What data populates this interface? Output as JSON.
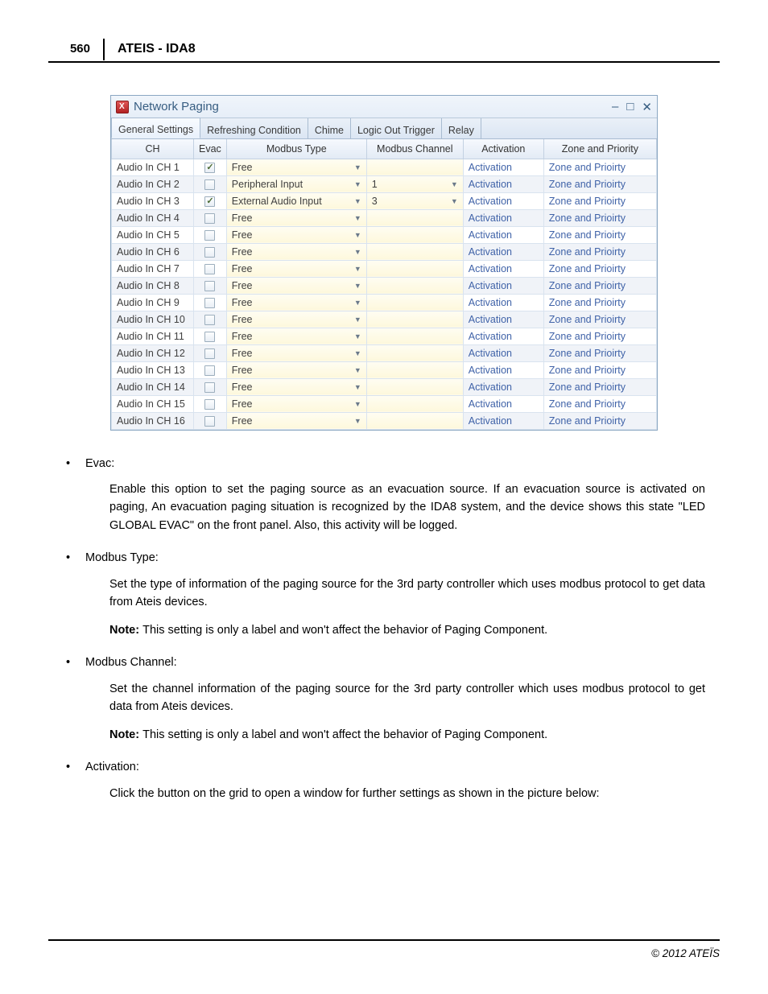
{
  "page": {
    "number": "560",
    "title": "ATEIS - IDA8",
    "footer": "© 2012 ATEÏS"
  },
  "window": {
    "title": "Network Paging",
    "tabs": [
      "General Settings",
      "Refreshing Condition",
      "Chime",
      "Logic Out Trigger",
      "Relay"
    ],
    "active_tab_index": 0,
    "columns": [
      "CH",
      "Evac",
      "Modbus Type",
      "Modbus Channel",
      "Activation",
      "Zone and  Priority"
    ],
    "rows": [
      {
        "ch": "Audio In CH 1",
        "evac": true,
        "mtype": "Free",
        "mchan": "",
        "act": "Activation",
        "zone": "Zone and Prioirty"
      },
      {
        "ch": "Audio In CH 2",
        "evac": false,
        "mtype": "Peripheral Input",
        "mchan": "1",
        "act": "Activation",
        "zone": "Zone and Prioirty"
      },
      {
        "ch": "Audio In CH 3",
        "evac": true,
        "mtype": "External Audio Input",
        "mchan": "3",
        "act": "Activation",
        "zone": "Zone and Prioirty"
      },
      {
        "ch": "Audio In CH 4",
        "evac": false,
        "mtype": "Free",
        "mchan": "",
        "act": "Activation",
        "zone": "Zone and Prioirty"
      },
      {
        "ch": "Audio In CH 5",
        "evac": false,
        "mtype": "Free",
        "mchan": "",
        "act": "Activation",
        "zone": "Zone and Prioirty"
      },
      {
        "ch": "Audio In CH 6",
        "evac": false,
        "mtype": "Free",
        "mchan": "",
        "act": "Activation",
        "zone": "Zone and Prioirty"
      },
      {
        "ch": "Audio In CH 7",
        "evac": false,
        "mtype": "Free",
        "mchan": "",
        "act": "Activation",
        "zone": "Zone and Prioirty"
      },
      {
        "ch": "Audio In CH 8",
        "evac": false,
        "mtype": "Free",
        "mchan": "",
        "act": "Activation",
        "zone": "Zone and Prioirty"
      },
      {
        "ch": "Audio In CH 9",
        "evac": false,
        "mtype": "Free",
        "mchan": "",
        "act": "Activation",
        "zone": "Zone and Prioirty"
      },
      {
        "ch": "Audio In CH 10",
        "evac": false,
        "mtype": "Free",
        "mchan": "",
        "act": "Activation",
        "zone": "Zone and Prioirty"
      },
      {
        "ch": "Audio In CH 11",
        "evac": false,
        "mtype": "Free",
        "mchan": "",
        "act": "Activation",
        "zone": "Zone and Prioirty"
      },
      {
        "ch": "Audio In CH 12",
        "evac": false,
        "mtype": "Free",
        "mchan": "",
        "act": "Activation",
        "zone": "Zone and Prioirty"
      },
      {
        "ch": "Audio In CH 13",
        "evac": false,
        "mtype": "Free",
        "mchan": "",
        "act": "Activation",
        "zone": "Zone and Prioirty"
      },
      {
        "ch": "Audio In CH 14",
        "evac": false,
        "mtype": "Free",
        "mchan": "",
        "act": "Activation",
        "zone": "Zone and Prioirty"
      },
      {
        "ch": "Audio In CH 15",
        "evac": false,
        "mtype": "Free",
        "mchan": "",
        "act": "Activation",
        "zone": "Zone and Prioirty"
      },
      {
        "ch": "Audio In CH 16",
        "evac": false,
        "mtype": "Free",
        "mchan": "",
        "act": "Activation",
        "zone": "Zone and Prioirty"
      }
    ]
  },
  "doc": {
    "items": [
      {
        "title": "Evac:",
        "desc": "Enable this option to set the paging source as an evacuation source. If an evacuation source is activated on paging, An evacuation paging situation is recognized by the IDA8 system, and the device shows this state \"LED GLOBAL EVAC\" on the front panel. Also, this activity will be logged."
      },
      {
        "title": "Modbus Type:",
        "desc": "Set the type of information of the paging source for the 3rd party controller which uses modbus protocol to get data from Ateis devices.",
        "note": "This setting is only a label and won't affect the behavior of Paging Component."
      },
      {
        "title": "Modbus Channel:",
        "desc": "Set the channel information of the paging source for the 3rd party controller which uses modbus protocol to get data from Ateis devices.",
        "note": "This setting is only a label and won't affect the behavior of Paging Component."
      },
      {
        "title": "Activation:",
        "desc": "Click the button on the grid to open a window for further settings as shown in the picture below:"
      }
    ],
    "note_label": "Note:"
  }
}
